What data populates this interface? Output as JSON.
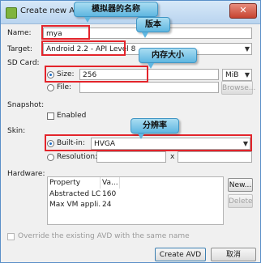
{
  "window": {
    "title": "Create new Android",
    "close_glyph": "✕",
    "icon": "android-app-icon"
  },
  "name": {
    "label": "Name:",
    "value": "mya"
  },
  "target": {
    "label": "Target:",
    "value": "Android 2.2 - API Level 8"
  },
  "sdcard": {
    "section_label": "SD Card:",
    "size_label": "Size:",
    "size_value": "256",
    "unit_value": "MiB",
    "file_label": "File:",
    "browse_label": "Browse..."
  },
  "snapshot": {
    "section_label": "Snapshot:",
    "enabled_label": "Enabled"
  },
  "skin": {
    "section_label": "Skin:",
    "builtin_label": "Built-in:",
    "builtin_value": "HVGA",
    "resolution_label": "Resolution:",
    "x_label": "x"
  },
  "hardware": {
    "section_label": "Hardware:",
    "columns": [
      "Property",
      "Va..."
    ],
    "rows": [
      {
        "property": "Abstracted LC...",
        "value": "160"
      },
      {
        "property": "Max VM appli...",
        "value": "24"
      }
    ],
    "new_label": "New...",
    "delete_label": "Delete"
  },
  "override_label": "Override the existing AVD with the same name",
  "footer": {
    "create_label": "Create AVD",
    "cancel_label": "取消"
  },
  "callouts": {
    "name": "模拟器的名称",
    "version": "版本",
    "memory": "内存大小",
    "resolution": "分辨率"
  },
  "colors": {
    "highlight": "#e3242b",
    "callout": "#5fb6e0",
    "accent": "#1f6fc9"
  }
}
